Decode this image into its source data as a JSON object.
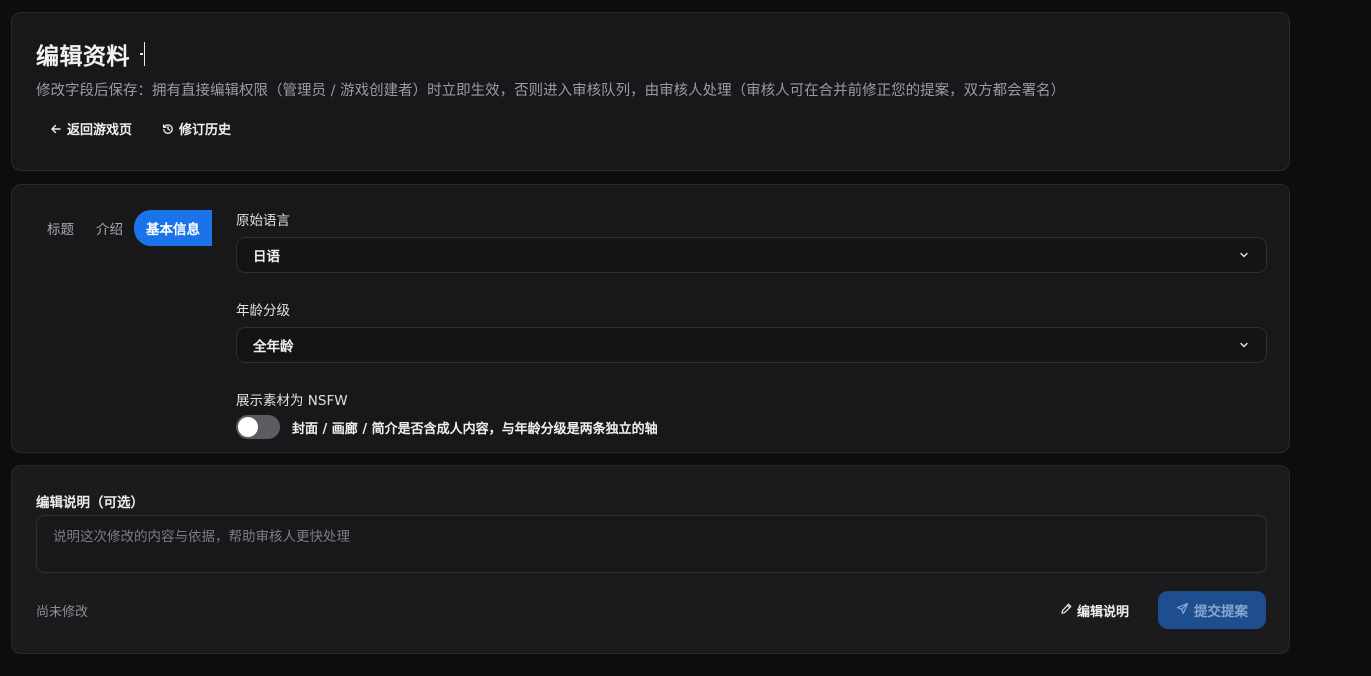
{
  "header": {
    "title": "编辑资料",
    "subtitle": "修改字段后保存：拥有直接编辑权限（管理员 / 游戏创建者）时立即生效，否则进入审核队列，由审核人处理（审核人可在合并前修正您的提案，双方都会署名）",
    "back_label": "返回游戏页",
    "history_label": "修订历史"
  },
  "tabs": [
    {
      "label": "标题",
      "active": false
    },
    {
      "label": "介绍",
      "active": false
    },
    {
      "label": "基本信息",
      "active": true
    }
  ],
  "form": {
    "language_label": "原始语言",
    "language_value": "日语",
    "age_label": "年龄分级",
    "age_value": "全年龄",
    "nsfw_label": "展示素材为 NSFW",
    "nsfw_desc": "封面 / 画廊 / 简介是否含成人内容，与年龄分级是两条独立的轴",
    "nsfw_enabled": false
  },
  "notes": {
    "label": "编辑说明（可选）",
    "placeholder": "说明这次修改的内容与依据，帮助审核人更快处理",
    "value": "",
    "status": "尚未修改",
    "edit_label": "编辑说明",
    "submit_label": "提交提案"
  },
  "icons": {
    "back": "arrow-left-icon",
    "history": "history-icon",
    "chevron": "chevron-down-icon",
    "edit": "pencil-icon",
    "submit": "send-icon"
  },
  "colors": {
    "accent": "#1a73e8",
    "submit_bg": "#1e4e8f",
    "background": "#0d0d0e",
    "card": "#18181b"
  }
}
